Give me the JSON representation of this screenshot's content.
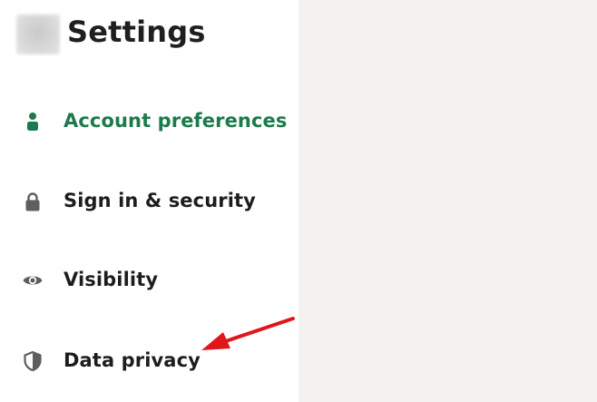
{
  "header": {
    "title": "Settings",
    "avatar_icon": "profile-avatar-blurred"
  },
  "sidebar": {
    "items": [
      {
        "id": "account",
        "label": "Account preferences",
        "icon": "person-icon",
        "active": true
      },
      {
        "id": "signin",
        "label": "Sign in & security",
        "icon": "lock-icon",
        "active": false
      },
      {
        "id": "visibility",
        "label": "Visibility",
        "icon": "eye-icon",
        "active": false
      },
      {
        "id": "privacy",
        "label": "Data privacy",
        "icon": "shield-icon",
        "active": false
      }
    ]
  },
  "colors": {
    "active_accent": "#1c7a4c",
    "text_default": "#1d1d1d",
    "icon_default": "#5e5e5e",
    "content_bg": "#f3f2ef",
    "annotation_arrow": "#e0161b"
  },
  "annotation": {
    "type": "red-arrow",
    "points_to": "Data privacy"
  }
}
